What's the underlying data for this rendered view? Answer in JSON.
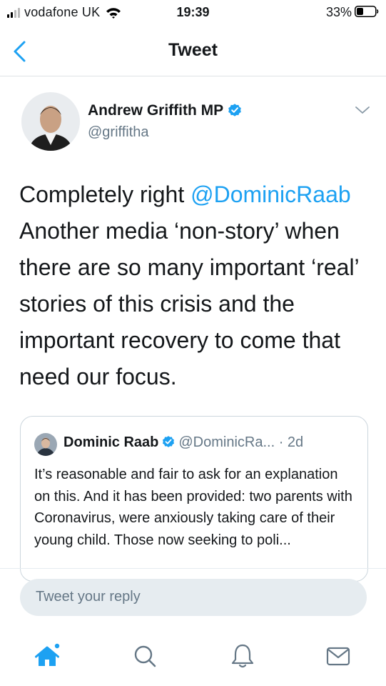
{
  "status_bar": {
    "carrier": "vodafone UK",
    "time": "19:39",
    "battery": "33%"
  },
  "nav": {
    "title": "Tweet"
  },
  "tweet": {
    "author": "Andrew Griffith MP",
    "handle": "@griffitha",
    "text_lead": "Completely right ",
    "mention": "@DominicRaab",
    "text_rest": " Another media ‘non-story’ when there are so many important ‘real’ stories of this crisis and the important recovery to come that need our focus."
  },
  "quoted": {
    "author": "Dominic Raab",
    "handle": "@DominicRa...",
    "separator": " · ",
    "age": "2d",
    "text": "It’s reasonable and fair to ask for an explanation on this. And it has been provided: two parents with Coronavirus, were anxiously taking care of their young child. Those now seeking to poli..."
  },
  "reply": {
    "placeholder": "Tweet your reply"
  },
  "colors": {
    "accent": "#1da1f2",
    "text": "#14171a",
    "secondary": "#657786",
    "border": "#dfe3e6"
  },
  "icons": [
    "back-chevron-icon",
    "verified-icon",
    "chevron-down-icon",
    "home-icon",
    "search-icon",
    "notifications-icon",
    "messages-icon"
  ]
}
